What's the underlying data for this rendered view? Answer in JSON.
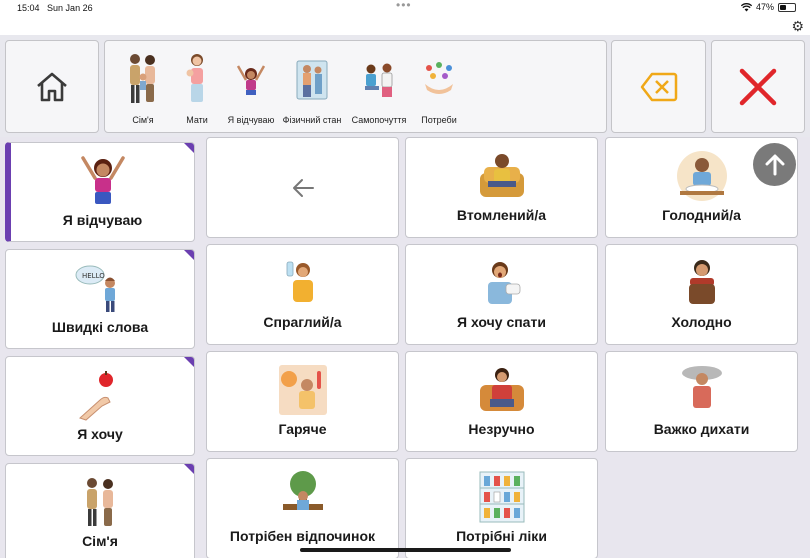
{
  "status": {
    "time": "15:04",
    "date": "Sun Jan 26",
    "battery": "47%"
  },
  "topbar": {
    "home_icon": "home-icon",
    "breadcrumb": [
      {
        "label": "Сім'я",
        "icon": "family-icon"
      },
      {
        "label": "Мати",
        "icon": "mother-icon"
      },
      {
        "label": "Я відчуваю",
        "icon": "i-feel-icon"
      },
      {
        "label": "Фізичний стан",
        "icon": "physical-state-icon"
      },
      {
        "label": "Самопочуття",
        "icon": "wellbeing-icon"
      },
      {
        "label": "Потреби",
        "icon": "needs-icon"
      }
    ],
    "delete_icon": "backspace-icon",
    "clear_icon": "close-icon"
  },
  "sidebar": [
    {
      "label": "Я відчуваю",
      "icon": "i-feel-icon",
      "active": true
    },
    {
      "label": "Швидкі слова",
      "icon": "quick-words-icon",
      "active": false
    },
    {
      "label": "Я хочу",
      "icon": "i-want-icon",
      "active": false
    },
    {
      "label": "Сім'я",
      "icon": "family-icon",
      "active": false
    }
  ],
  "grid": {
    "back_icon": "arrow-left-icon",
    "tiles": [
      {
        "label": "Втомлений/а",
        "icon": "tired-icon"
      },
      {
        "label": "Голодний/а",
        "icon": "hungry-icon"
      },
      {
        "label": "Спраглий/а",
        "icon": "thirsty-icon"
      },
      {
        "label": "Я хочу спати",
        "icon": "sleepy-icon"
      },
      {
        "label": "Холодно",
        "icon": "cold-icon"
      },
      {
        "label": "Гаряче",
        "icon": "hot-icon"
      },
      {
        "label": "Незручно",
        "icon": "uncomfortable-icon"
      },
      {
        "label": "Важко дихати",
        "icon": "hard-to-breathe-icon"
      },
      {
        "label": "Потрібен відпочинок",
        "icon": "need-rest-icon"
      },
      {
        "label": "Потрібні ліки",
        "icon": "need-medicine-icon"
      }
    ]
  },
  "colors": {
    "accent": "#6b3fb0",
    "clear": "#e0262b",
    "delete": "#f0a818"
  }
}
